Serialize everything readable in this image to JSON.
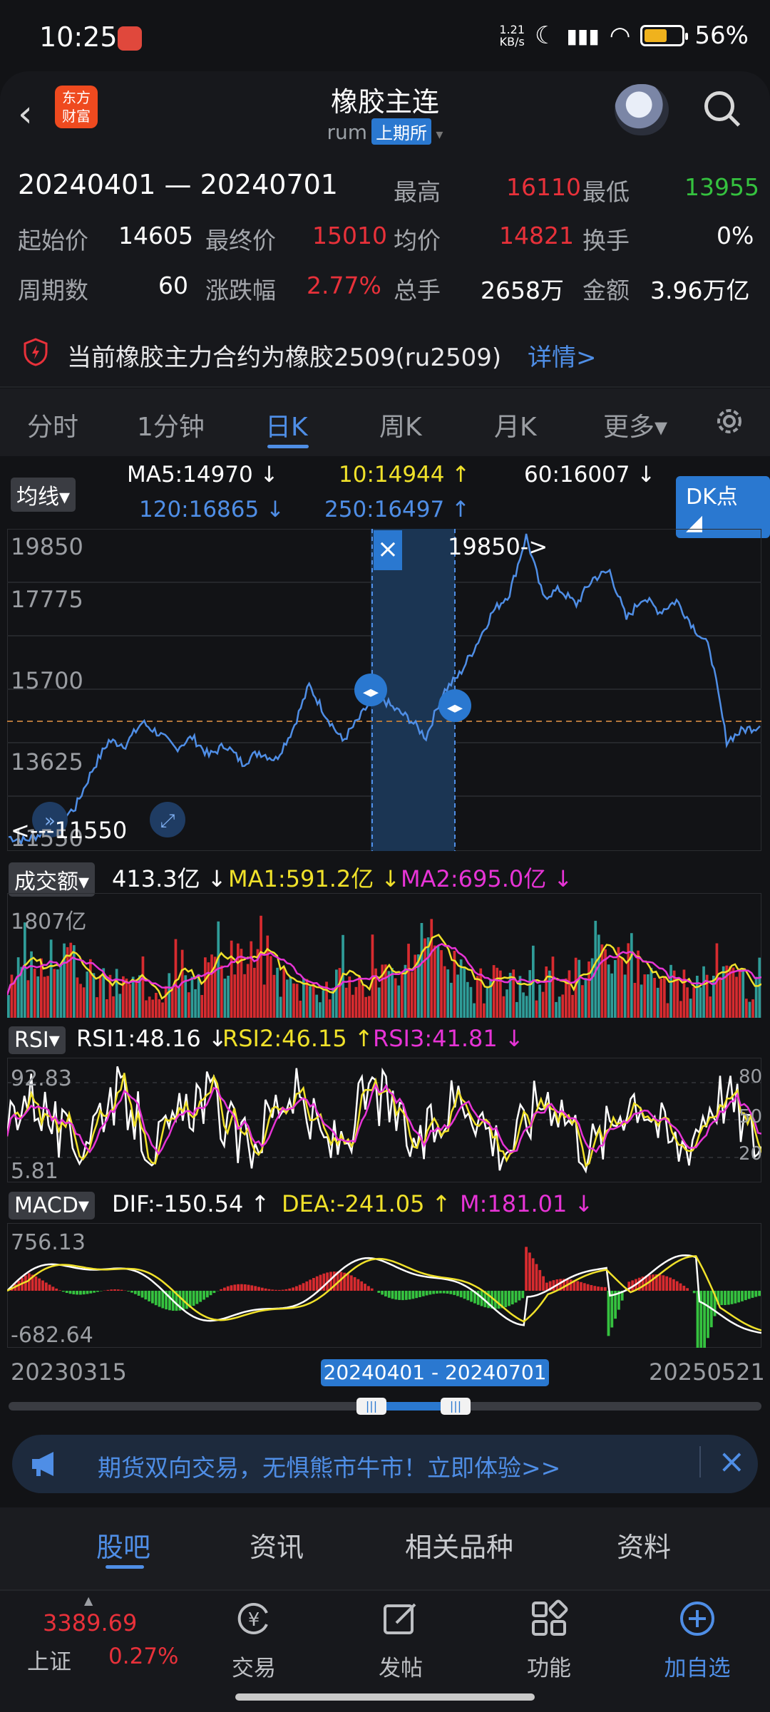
{
  "status_bar": {
    "time": "10:25",
    "speed": "1.21\nKB/s",
    "battery": "56%"
  },
  "header": {
    "back_icon": "chevron-left-icon",
    "title": "橡胶主连",
    "code": "rum",
    "exchange": "上期所",
    "logo_text": "东方\n财富"
  },
  "summary": {
    "date_range": "20240401 — 20240701",
    "high_label": "最高",
    "high": "16110",
    "low_label": "最低",
    "low": "13955",
    "open_label": "起始价",
    "open": "14605",
    "close_label": "最终价",
    "close": "15010",
    "avg_label": "均价",
    "avg": "14821",
    "turnover_label": "换手",
    "turnover": "0%",
    "periods_label": "周期数",
    "periods": "60",
    "change_label": "涨跌幅",
    "change": "2.77%",
    "volume_label": "总手",
    "volume": "2658万",
    "amount_label": "金额",
    "amount": "3.96万亿"
  },
  "notice": {
    "text": "当前橡胶主力合约为橡胶2509(ru2509)",
    "link": "详情>"
  },
  "tabs": [
    "分时",
    "1分钟",
    "日K",
    "周K",
    "月K",
    "更多▾"
  ],
  "active_tab": "日K",
  "ma": {
    "dropdown": "均线▾",
    "ma5": "MA5:14970 ↓",
    "ma10": "10:14944 ↑",
    "ma60": "60:16007 ↓",
    "ma120": "120:16865 ↓",
    "ma250": "250:16497 ↑",
    "dk": "DK点 ◢"
  },
  "price_axis": [
    "19850",
    "17775",
    "15700",
    "13625",
    "11550"
  ],
  "price_max_marker": "19850->",
  "price_min_marker": "<---11550",
  "volume_panel": {
    "dropdown": "成交额▾",
    "v": "413.3亿 ↓",
    "ma1": "MA1:591.2亿 ↓",
    "ma2": "MA2:695.0亿 ↓",
    "max": "1807亿"
  },
  "rsi_panel": {
    "dropdown": "RSI▾",
    "rsi1": "RSI1:48.16 ↓",
    "rsi2": "RSI2:46.15 ↑",
    "rsi3": "RSI3:41.81 ↓",
    "max": "92.83",
    "min": "5.81",
    "r80": "80",
    "r50": "50",
    "r20": "20"
  },
  "macd_panel": {
    "dropdown": "MACD▾",
    "dif": "DIF:-150.54 ↑",
    "dea": "DEA:-241.05 ↑",
    "m": "M:181.01 ↓",
    "max": "756.13",
    "min": "-682.64"
  },
  "range": {
    "start": "20230315",
    "end": "20250521",
    "selected": "20240401 - 20240701"
  },
  "banner": {
    "text": "期货双向交易，无惧熊市牛市！立即体验>>"
  },
  "bottom_tabs": [
    "股吧",
    "资讯",
    "相关品种",
    "资料"
  ],
  "nav": {
    "index_value": "3389.69",
    "index_name": "上证",
    "index_change": "0.27%",
    "items": [
      "交易",
      "发帖",
      "功能",
      "加自选"
    ]
  },
  "colors": {
    "accent": "#4f8ee6",
    "up": "#e8313a",
    "down": "#35c23f",
    "yellow": "#f0e12a",
    "magenta": "#e734d6"
  },
  "chart_data": {
    "type": "line",
    "title": "",
    "x_range": [
      "20230315",
      "20250521"
    ],
    "ylim": [
      11550,
      19850
    ],
    "series": [
      {
        "name": "",
        "values": [
          11700,
          11600,
          11800,
          12100,
          12500,
          13500,
          14300,
          14200,
          14800,
          14500,
          14100,
          14400,
          13900,
          14200,
          13700,
          14000,
          13800,
          14600,
          15800,
          15000,
          14300,
          14900,
          15600,
          15200,
          14900,
          14400,
          15600,
          16100,
          16900,
          17800,
          18300,
          19850,
          18200,
          18400,
          18000,
          18700,
          18900,
          17600,
          18200,
          17800,
          18100,
          17400,
          16800,
          14300,
          14600,
          14700
        ]
      }
    ],
    "selected_range": [
      "20240401",
      "20240701"
    ]
  }
}
